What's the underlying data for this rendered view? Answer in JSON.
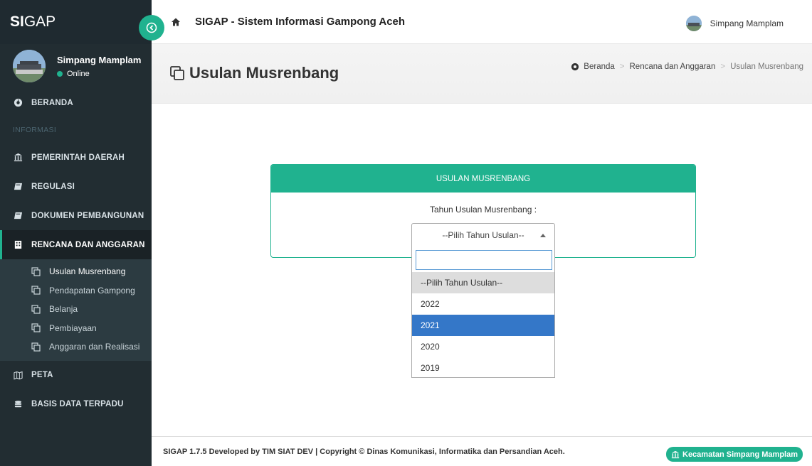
{
  "brand": {
    "logo_bold": "SI",
    "logo_rest": "GAP"
  },
  "user": {
    "name": "Simpang Mamplam",
    "status": "Online"
  },
  "sidebar": {
    "beranda": "BERANDA",
    "header_info": "INFORMASI",
    "items": [
      {
        "label": "PEMERINTAH DAERAH",
        "icon": "bank-icon"
      },
      {
        "label": "REGULASI",
        "icon": "book-icon"
      },
      {
        "label": "DOKUMEN PEMBANGUNAN",
        "icon": "book-icon"
      },
      {
        "label": "RENCANA DAN ANGGARAN",
        "icon": "building-icon"
      }
    ],
    "submenu": [
      "Usulan Musrenbang",
      "Pendapatan Gampong",
      "Belanja",
      "Pembiayaan",
      "Anggaran dan Realisasi"
    ],
    "peta": "PETA",
    "basis_data": "BASIS DATA TERPADU"
  },
  "topbar": {
    "title": "SIGAP - Sistem Informasi Gampong Aceh",
    "user_name": "Simpang Mamplam"
  },
  "page": {
    "title": "Usulan Musrenbang",
    "breadcrumb": [
      "Beranda",
      "Rencana dan Anggaran",
      "Usulan Musrenbang"
    ]
  },
  "panel": {
    "heading": "USULAN MUSRENBANG",
    "label": "Tahun Usulan Musrenbang :",
    "select_value": "--Pilih Tahun Usulan--",
    "search_value": "",
    "options": [
      "--Pilih Tahun Usulan--",
      "2022",
      "2021",
      "2020",
      "2019"
    ],
    "highlighted_option": "2021"
  },
  "footer": {
    "text": "SIGAP 1.7.5 Developed by TIM SIAT DEV | Copyright © Dinas Komunikasi, Informatika dan Persandian Aceh.",
    "badge": "Kecamatan Simpang Mamplam"
  },
  "colors": {
    "accent": "#20b28f",
    "sidebar_bg": "#222d32",
    "highlight": "#3477c8"
  }
}
